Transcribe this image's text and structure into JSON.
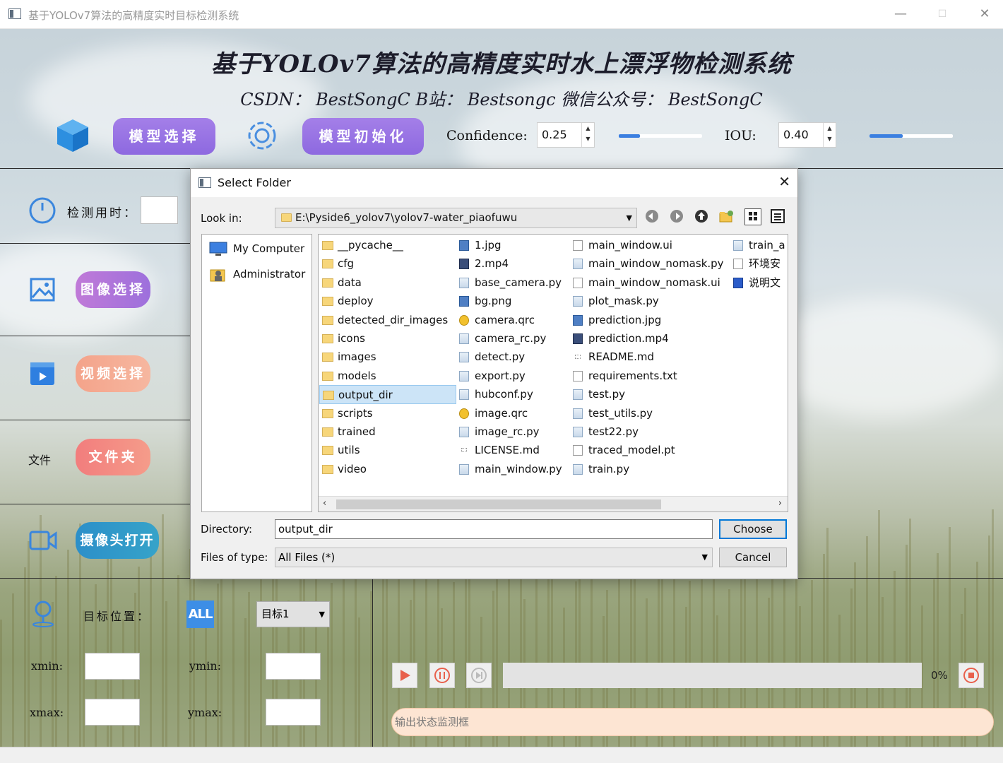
{
  "window": {
    "title": "基于YOLOv7算法的高精度实时目标检测系统",
    "minimize": "—",
    "maximize": "☐",
    "close": "✕"
  },
  "header": {
    "title": "基于YOLOv7算法的高精度实时水上漂浮物检测系统",
    "subtitle": "CSDN： BestSongC   B站： Bestsongc   微信公众号： BestSongC"
  },
  "toolbar": {
    "model_select_label": "模型选择",
    "model_init_label": "模型初始化",
    "confidence_label": "Confidence:",
    "confidence_value": "0.25",
    "confidence_slider": 0.25,
    "iou_label": "IOU:",
    "iou_value": "0.40",
    "iou_slider": 0.4
  },
  "sidebar": {
    "detect_time_label": "检测用时：",
    "image_button": "图像选择",
    "video_button": "视频选择",
    "folder_label": "文件",
    "folder_button": "文件夹",
    "camera_button": "摄像头打开"
  },
  "target": {
    "position_label": "目标位置：",
    "all_button": "ALL",
    "select_value": "目标1",
    "xmin_label": "xmin:",
    "ymin_label": "ymin:",
    "xmax_label": "xmax:",
    "ymax_label": "ymax:"
  },
  "player": {
    "progress_text": "0%",
    "progress_value": 0,
    "status_text": "输出状态监测框"
  },
  "dialog": {
    "title": "Select Folder",
    "close": "✕",
    "look_in_label": "Look in:",
    "look_in_path": "E:\\Pyside6_yolov7\\yolov7-water_piaofuwu",
    "sidebar_items": [
      "My Computer",
      "Administrator"
    ],
    "columns": [
      [
        {
          "name": "__pycache__",
          "type": "folder"
        },
        {
          "name": "cfg",
          "type": "folder"
        },
        {
          "name": "data",
          "type": "folder"
        },
        {
          "name": "deploy",
          "type": "folder"
        },
        {
          "name": "detected_dir_images",
          "type": "folder"
        },
        {
          "name": "icons",
          "type": "folder"
        },
        {
          "name": "images",
          "type": "folder"
        },
        {
          "name": "models",
          "type": "folder"
        },
        {
          "name": "output_dir",
          "type": "folder"
        },
        {
          "name": "scripts",
          "type": "folder"
        },
        {
          "name": "trained",
          "type": "folder"
        },
        {
          "name": "utils",
          "type": "folder"
        },
        {
          "name": "video",
          "type": "folder"
        }
      ],
      [
        {
          "name": "1.jpg",
          "type": "img"
        },
        {
          "name": "2.mp4",
          "type": "vid"
        },
        {
          "name": "base_camera.py",
          "type": "py"
        },
        {
          "name": "bg.png",
          "type": "img"
        },
        {
          "name": "camera.qrc",
          "type": "qrc"
        },
        {
          "name": "camera_rc.py",
          "type": "py"
        },
        {
          "name": "detect.py",
          "type": "py"
        },
        {
          "name": "export.py",
          "type": "py"
        },
        {
          "name": "hubconf.py",
          "type": "py"
        },
        {
          "name": "image.qrc",
          "type": "qrc"
        },
        {
          "name": "image_rc.py",
          "type": "py"
        },
        {
          "name": "LICENSE.md",
          "type": "md"
        },
        {
          "name": "main_window.py",
          "type": "py"
        }
      ],
      [
        {
          "name": "main_window.ui",
          "type": "doc"
        },
        {
          "name": "main_window_nomask.py",
          "type": "py"
        },
        {
          "name": "main_window_nomask.ui",
          "type": "doc"
        },
        {
          "name": "plot_mask.py",
          "type": "py"
        },
        {
          "name": "prediction.jpg",
          "type": "img"
        },
        {
          "name": "prediction.mp4",
          "type": "vid"
        },
        {
          "name": "README.md",
          "type": "md"
        },
        {
          "name": "requirements.txt",
          "type": "doc"
        },
        {
          "name": "test.py",
          "type": "py"
        },
        {
          "name": "test_utils.py",
          "type": "py"
        },
        {
          "name": "test22.py",
          "type": "py"
        },
        {
          "name": "traced_model.pt",
          "type": "doc"
        },
        {
          "name": "train.py",
          "type": "py"
        }
      ],
      [
        {
          "name": "train_a",
          "type": "py"
        },
        {
          "name": "环境安",
          "type": "doc"
        },
        {
          "name": "说明文",
          "type": "word"
        }
      ]
    ],
    "selected": "output_dir",
    "directory_label": "Directory:",
    "directory_value": "output_dir",
    "files_type_label": "Files of type:",
    "files_type_value": "All Files (*)",
    "choose_button": "Choose",
    "cancel_button": "Cancel"
  }
}
